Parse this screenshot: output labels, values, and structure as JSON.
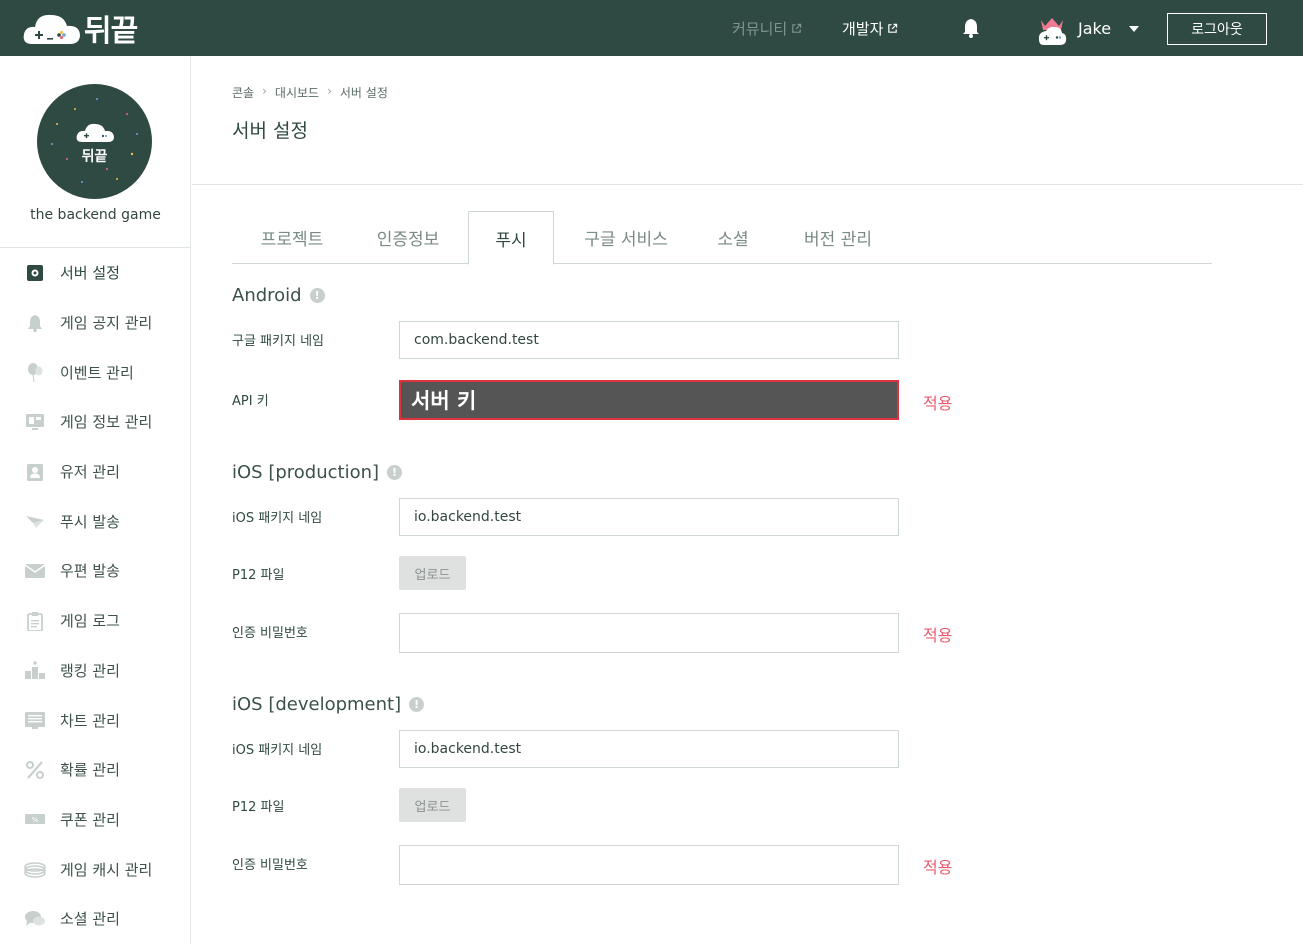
{
  "header": {
    "logo_text": "뒤끝",
    "community_label": "커뮤니티",
    "developer_label": "개발자",
    "user_name": "Jake",
    "logout_label": "로그아웃"
  },
  "sidebar": {
    "logo_text": "뒤끝",
    "project_name": "the backend game",
    "items": [
      {
        "label": "서버 설정",
        "icon": "gear-icon"
      },
      {
        "label": "게임 공지 관리",
        "icon": "bell-icon"
      },
      {
        "label": "이벤트 관리",
        "icon": "balloon-icon"
      },
      {
        "label": "게임 정보 관리",
        "icon": "monitor-icon"
      },
      {
        "label": "유저 관리",
        "icon": "user-card-icon"
      },
      {
        "label": "푸시 발송",
        "icon": "paper-plane-icon"
      },
      {
        "label": "우편 발송",
        "icon": "envelope-icon"
      },
      {
        "label": "게임 로그",
        "icon": "clipboard-icon"
      },
      {
        "label": "랭킹 관리",
        "icon": "podium-icon"
      },
      {
        "label": "차트 관리",
        "icon": "chart-sheet-icon"
      },
      {
        "label": "확률 관리",
        "icon": "percent-icon"
      },
      {
        "label": "쿠폰 관리",
        "icon": "coupon-icon"
      },
      {
        "label": "게임 캐시 관리",
        "icon": "cash-icon"
      },
      {
        "label": "소셜 관리",
        "icon": "chat-bubbles-icon"
      }
    ]
  },
  "breadcrumb": [
    "콘솔",
    "대시보드",
    "서버 설정"
  ],
  "page_title": "서버 설정",
  "tabs": [
    {
      "label": "프로젝트"
    },
    {
      "label": "인증정보"
    },
    {
      "label": "푸시"
    },
    {
      "label": "구글 서비스"
    },
    {
      "label": "소셜"
    },
    {
      "label": "버전 관리"
    }
  ],
  "android": {
    "title": "Android",
    "package_label": "구글 패키지 네임",
    "package_value": "com.backend.test",
    "api_key_label": "API 키",
    "api_key_value": "서버 키",
    "apply_label": "적용"
  },
  "ios_production": {
    "title": "iOS [production]",
    "package_label": "iOS 패키지 네임",
    "package_value": "io.backend.test",
    "p12_label": "P12 파일",
    "upload_label": "업로드",
    "password_label": "인증 비밀번호",
    "password_value": "",
    "apply_label": "적용"
  },
  "ios_development": {
    "title": "iOS [development]",
    "package_label": "iOS 패키지 네임",
    "package_value": "io.backend.test",
    "p12_label": "P12 파일",
    "upload_label": "업로드",
    "password_label": "인증 비밀번호",
    "password_value": "",
    "apply_label": "적용"
  },
  "colors": {
    "header_bg": "#2f4a42",
    "accent_red": "#ee5b6e",
    "redact_bg": "#555555",
    "redact_border": "#e0323c"
  }
}
